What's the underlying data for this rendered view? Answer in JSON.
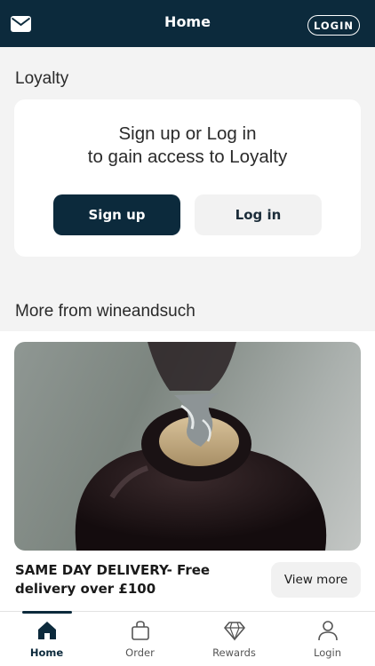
{
  "header": {
    "title": "Home",
    "login_label": "LOGIN",
    "mail_icon": "envelope-icon"
  },
  "loyalty": {
    "section_title": "Loyalty",
    "line1": "Sign up or Log in",
    "line2": "to gain access to Loyalty",
    "signup_label": "Sign up",
    "login_label": "Log in"
  },
  "more": {
    "section_title": "More from wineandsuch",
    "promo_text": "SAME DAY DELIVERY- Free delivery over £100",
    "view_more_label": "View more"
  },
  "nav": {
    "items": [
      {
        "label": "Home",
        "icon": "home-icon",
        "active": true
      },
      {
        "label": "Order",
        "icon": "bag-icon",
        "active": false
      },
      {
        "label": "Rewards",
        "icon": "diamond-icon",
        "active": false
      },
      {
        "label": "Login",
        "icon": "user-icon",
        "active": false
      }
    ]
  },
  "colors": {
    "brand_dark": "#0c2a3c",
    "background": "#f3f3f3"
  }
}
